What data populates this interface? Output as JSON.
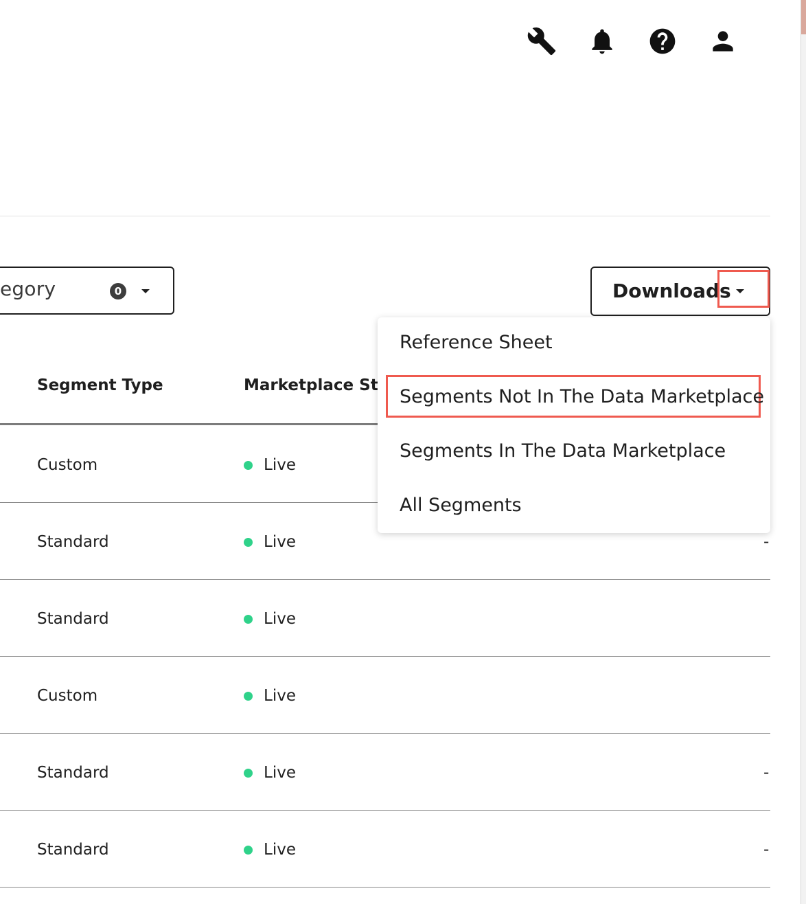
{
  "header": {
    "icons": [
      "wrench-icon",
      "bell-icon",
      "help-icon",
      "user-icon"
    ]
  },
  "filter": {
    "label": "egory",
    "count": "0"
  },
  "downloads": {
    "label": "Downloads",
    "menu_items": [
      "Reference Sheet",
      "Segments Not In The Data Marketplace",
      "Segments In The Data Marketplace",
      "All Segments"
    ],
    "highlighted_item": "Segments Not In The Data Marketplace"
  },
  "table": {
    "columns": [
      "Segment Type",
      "Marketplace Stat"
    ],
    "rows": [
      {
        "type": "Custom",
        "status": "Live",
        "trailing": ""
      },
      {
        "type": "Standard",
        "status": "Live",
        "trailing": "-"
      },
      {
        "type": "Standard",
        "status": "Live",
        "trailing": ""
      },
      {
        "type": "Custom",
        "status": "Live",
        "trailing": ""
      },
      {
        "type": "Standard",
        "status": "Live",
        "trailing": "-"
      },
      {
        "type": "Standard",
        "status": "Live",
        "trailing": "-"
      }
    ]
  },
  "colors": {
    "highlight": "#ef5a4f",
    "live_dot": "#2fd28a",
    "text": "#1f1f1f"
  }
}
